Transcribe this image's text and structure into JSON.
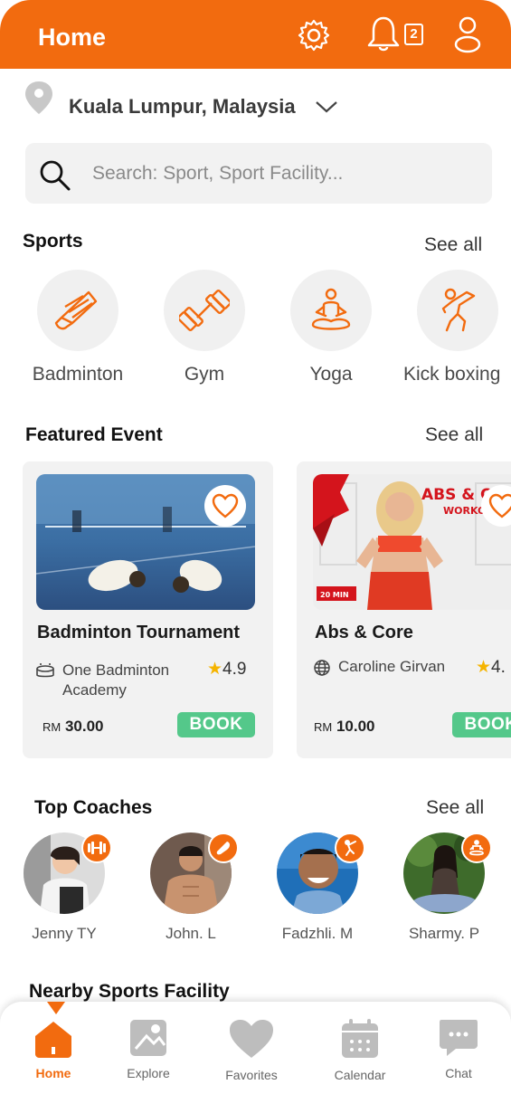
{
  "colors": {
    "brand": "#f26b0f",
    "book": "#54c88a",
    "star": "#f5b400"
  },
  "header": {
    "title": "Home",
    "notification_count": "2",
    "icons": [
      "gear-icon",
      "bell-icon",
      "user-icon"
    ]
  },
  "location": {
    "text": "Kuala Lumpur, Malaysia"
  },
  "search": {
    "placeholder": "Search: Sport, Sport Facility..."
  },
  "sports": {
    "title": "Sports",
    "see_all": "See all",
    "items": [
      {
        "label": "Badminton",
        "icon": "shuttlecock-icon"
      },
      {
        "label": "Gym",
        "icon": "dumbbell-icon"
      },
      {
        "label": "Yoga",
        "icon": "yoga-icon"
      },
      {
        "label": "Kick boxing",
        "icon": "kick-icon"
      }
    ]
  },
  "featured": {
    "title": "Featured Event",
    "see_all": "See all",
    "events": [
      {
        "title": "Badminton Tournament",
        "venue": "One Badminton Academy",
        "rating": "4.9",
        "currency": "RM",
        "price": "30.00",
        "book": "BOOK"
      },
      {
        "title": "Abs & Core",
        "venue": "Caroline Girvan",
        "rating": "4.",
        "currency": "RM",
        "price": "10.00",
        "book": "BOOK",
        "img_text": "ABS & C",
        "img_sub": "WORKO",
        "img_tag": "20 MIN"
      }
    ]
  },
  "coaches": {
    "title": "Top Coaches",
    "see_all": "See all",
    "items": [
      {
        "name": "Jenny TY",
        "badge": "dumbbell-icon"
      },
      {
        "name": "John. L",
        "badge": "shuttlecock-icon"
      },
      {
        "name": "Fadzhli. M",
        "badge": "kick-icon"
      },
      {
        "name": "Sharmy. P",
        "badge": "yoga-icon"
      }
    ]
  },
  "nearby": {
    "title": "Nearby Sports Facility"
  },
  "nav": {
    "items": [
      {
        "label": "Home",
        "icon": "home-icon",
        "active": true
      },
      {
        "label": "Explore",
        "icon": "map-icon"
      },
      {
        "label": "Favorites",
        "icon": "heart-icon"
      },
      {
        "label": "Calendar",
        "icon": "calendar-icon"
      },
      {
        "label": "Chat",
        "icon": "chat-icon"
      }
    ]
  }
}
